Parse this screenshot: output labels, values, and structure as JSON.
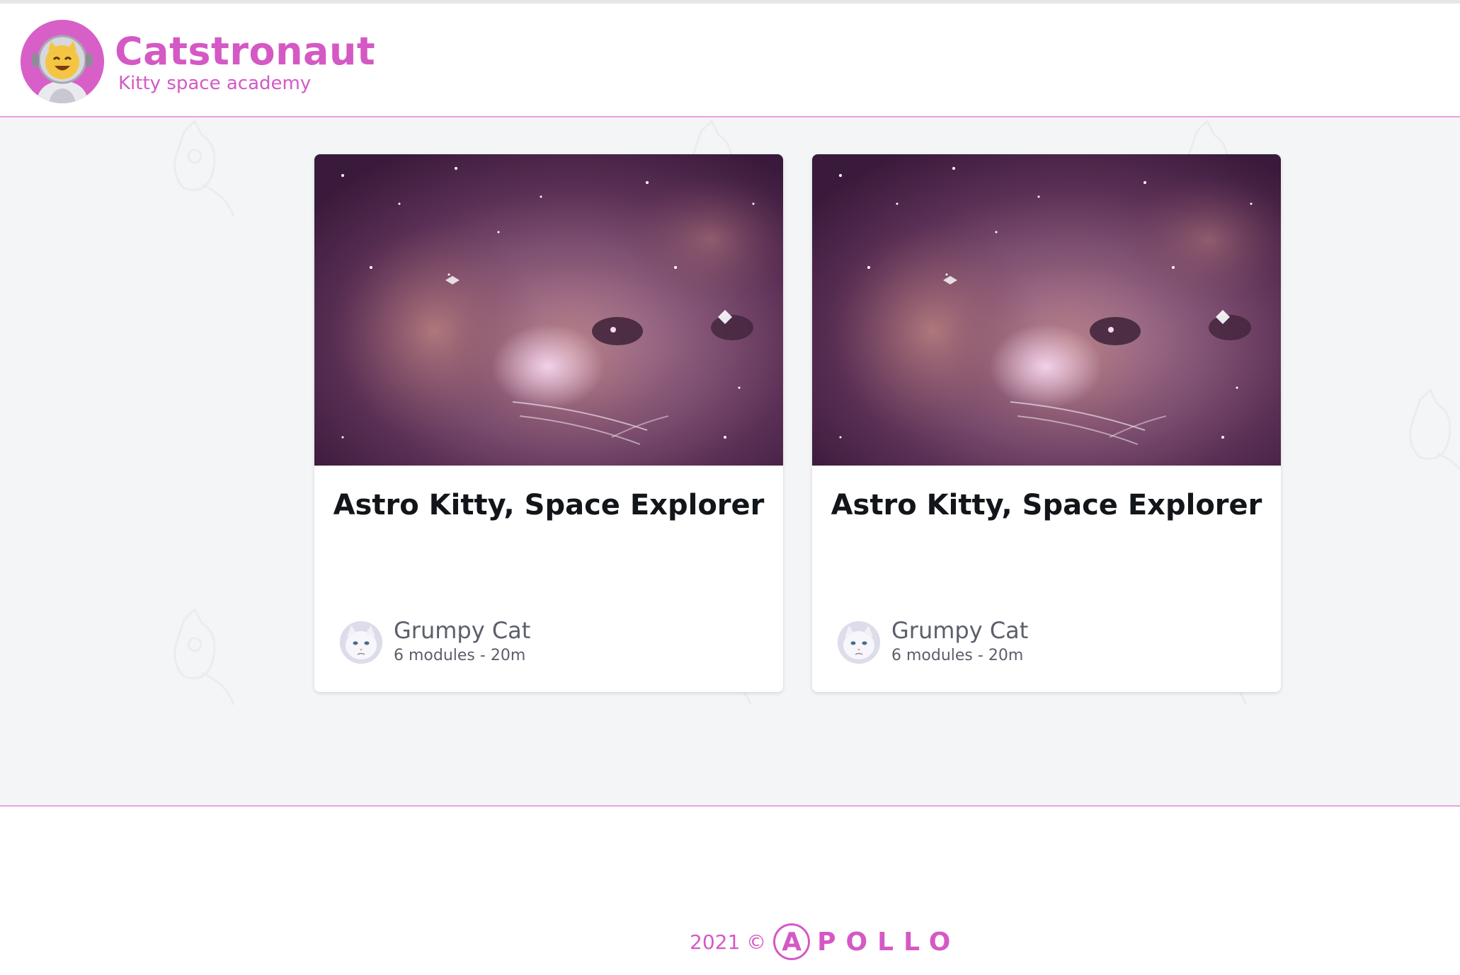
{
  "header": {
    "title": "Catstronaut",
    "subtitle": "Kitty space academy",
    "logo_icon": "astronaut-cat-logo-icon"
  },
  "colors": {
    "brand": "#d459c4",
    "divider": "#e6a3dd",
    "background": "#f4f5f7",
    "card_title": "#12151a",
    "muted_text": "#5b5f6a"
  },
  "tracks": [
    {
      "title": "Astro Kitty, Space Explorer",
      "image_icon": "space-cat-nebula-image",
      "author": "Grumpy Cat",
      "meta": "6 modules - 20m"
    },
    {
      "title": "Astro Kitty, Space Explorer",
      "image_icon": "space-cat-nebula-image",
      "author": "Grumpy Cat",
      "meta": "6 modules - 20m"
    }
  ],
  "footer": {
    "copyright": "2021 ©",
    "apollo_initial": "A",
    "apollo_rest": "POLLO"
  }
}
